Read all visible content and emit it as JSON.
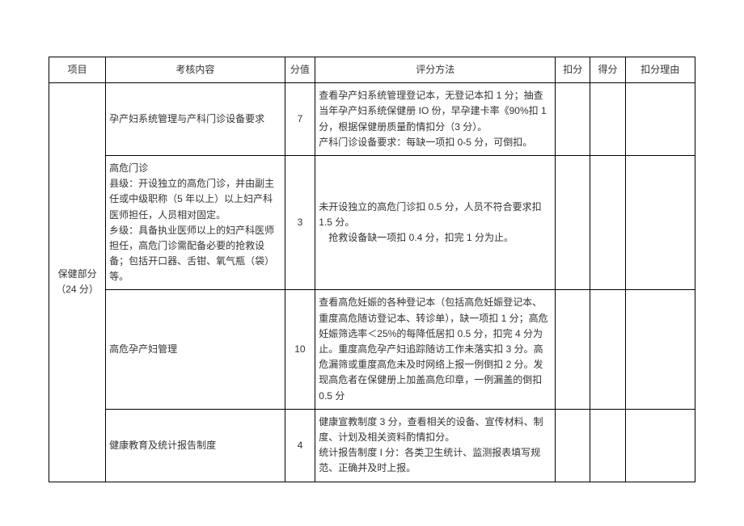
{
  "headers": {
    "project": "项目",
    "content": "考核内容",
    "score": "分值",
    "method": "评分方法",
    "deduct": "扣分",
    "gain": "得分",
    "reason": "扣分理由"
  },
  "section": {
    "project_label": "保健部分（24 分）"
  },
  "rows": [
    {
      "content": "孕产妇系统管理与产科门诊设备要求",
      "score": "7",
      "method": "查看孕产妇系统管理登记本，无登记本扣 1 分；抽查当年孕产妇系统保健册 IO 份，早孕建卡率《90%扣 1 分，根据保健册质量酌情扣分（3 分）。\n产科门诊设备要求：每缺一项扣 0-5 分，可倒扣。"
    },
    {
      "content": "高危门诊\n县级：开设独立的高危门诊，并由副主任或中级职称（5 年以上）以上妇产科医师担任，人员相对固定。\n乡级：具备执业医师以上的妇产科医师担任，高危门诊需配备必要的抢救设备；包括开口器、舌钳、氧气瓶（袋）等。",
      "score": "3",
      "method": "未开设独立的高危门诊扣 0.5 分，人员不符合要求扣 1.5 分。\n　抢救设备缺一项扣 0.4 分，扣完 1 分为止。"
    },
    {
      "content": "高危孕产妇管理",
      "score": "10",
      "method": "查看高危妊娠的各种登记本（包括高危妊娠登记本、重度高危随访登记本、转诊单），缺一项扣 1 分；高危妊娠筛选率＜25%的每降低居扣 0.5 分，扣完 4 分为止。重度高危孕产妇追踪随访工作未落实扣 3 分。高危漏筛或重度高危未及时网络上报一例倒扣 2 分。发现高危者在保健册上加盖高危印章，一例漏盖的倒扣 0.5 分"
    },
    {
      "content": "健康教育及统计报告制度",
      "score": "4",
      "method": "健康宣教制度 3 分，查看相关的设备、宣传材料、制度、计划及相关资料酌情扣分。\n统计报告制度 I 分：各类卫生统计、监测报表填写规范、正确并及时上报。"
    }
  ]
}
